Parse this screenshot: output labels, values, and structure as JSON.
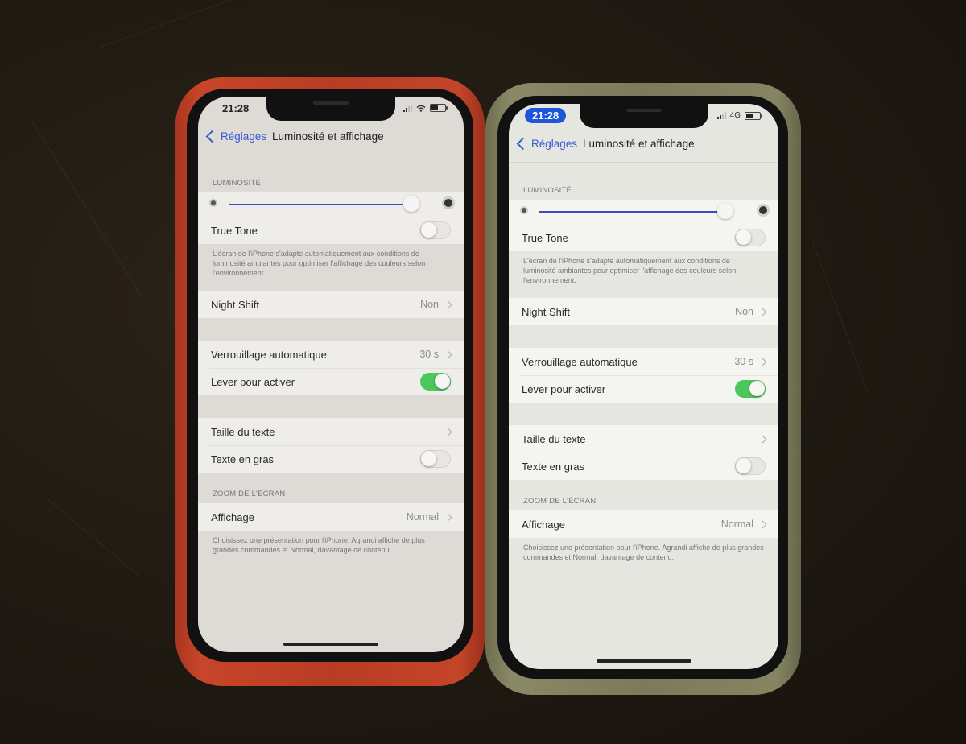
{
  "phones": [
    {
      "case_color": "red",
      "status": {
        "time": "21:28",
        "network": "wifi",
        "time_pill": false
      },
      "nav": {
        "back_label": "Réglages",
        "title": "Luminosité et affichage"
      },
      "brightness": {
        "section_header": "LUMINOSITÉ",
        "level": 0.96
      },
      "true_tone": {
        "label": "True Tone",
        "on": false,
        "footer": "L'écran de l'iPhone s'adapte automatiquement aux conditions de luminosité ambiantes pour optimiser l'affichage des couleurs selon l'environnement."
      },
      "night_shift": {
        "label": "Night Shift",
        "value": "Non"
      },
      "lock": {
        "label": "Verrouillage automatique",
        "value": "30 s"
      },
      "raise": {
        "label": "Lever pour activer",
        "on": true
      },
      "text_size": {
        "label": "Taille du texte"
      },
      "bold_text": {
        "label": "Texte en gras",
        "on": false
      },
      "zoom": {
        "section_header": "ZOOM DE L'ÉCRAN",
        "label": "Affichage",
        "value": "Normal",
        "footer": "Choisissez une présentation pour l'iPhone. Agrandi affiche de plus grandes commandes et Normal, davantage de contenu."
      }
    },
    {
      "case_color": "olive",
      "status": {
        "time": "21:28",
        "network": "4G",
        "time_pill": true
      },
      "nav": {
        "back_label": "Réglages",
        "title": "Luminosité et affichage"
      },
      "brightness": {
        "section_header": "LUMINOSITÉ",
        "level": 0.96
      },
      "true_tone": {
        "label": "True Tone",
        "on": false,
        "footer": "L'écran de l'iPhone s'adapte automatiquement aux conditions de luminosité ambiantes pour optimiser l'affichage des couleurs selon l'environnement."
      },
      "night_shift": {
        "label": "Night Shift",
        "value": "Non"
      },
      "lock": {
        "label": "Verrouillage automatique",
        "value": "30 s"
      },
      "raise": {
        "label": "Lever pour activer",
        "on": true
      },
      "text_size": {
        "label": "Taille du texte"
      },
      "bold_text": {
        "label": "Texte en gras",
        "on": false
      },
      "zoom": {
        "section_header": "ZOOM DE L'ÉCRAN",
        "label": "Affichage",
        "value": "Normal",
        "footer": "Choisissez une présentation pour l'iPhone. Agrandi affiche de plus grandes commandes et Normal, davantage de contenu."
      }
    }
  ],
  "colors": {
    "accent_blue": "#3b5bd6",
    "toggle_on": "#4cc75c",
    "red_case": "#c0412a",
    "olive_case": "#7e7d5c",
    "time_pill": "#1d56d8"
  }
}
